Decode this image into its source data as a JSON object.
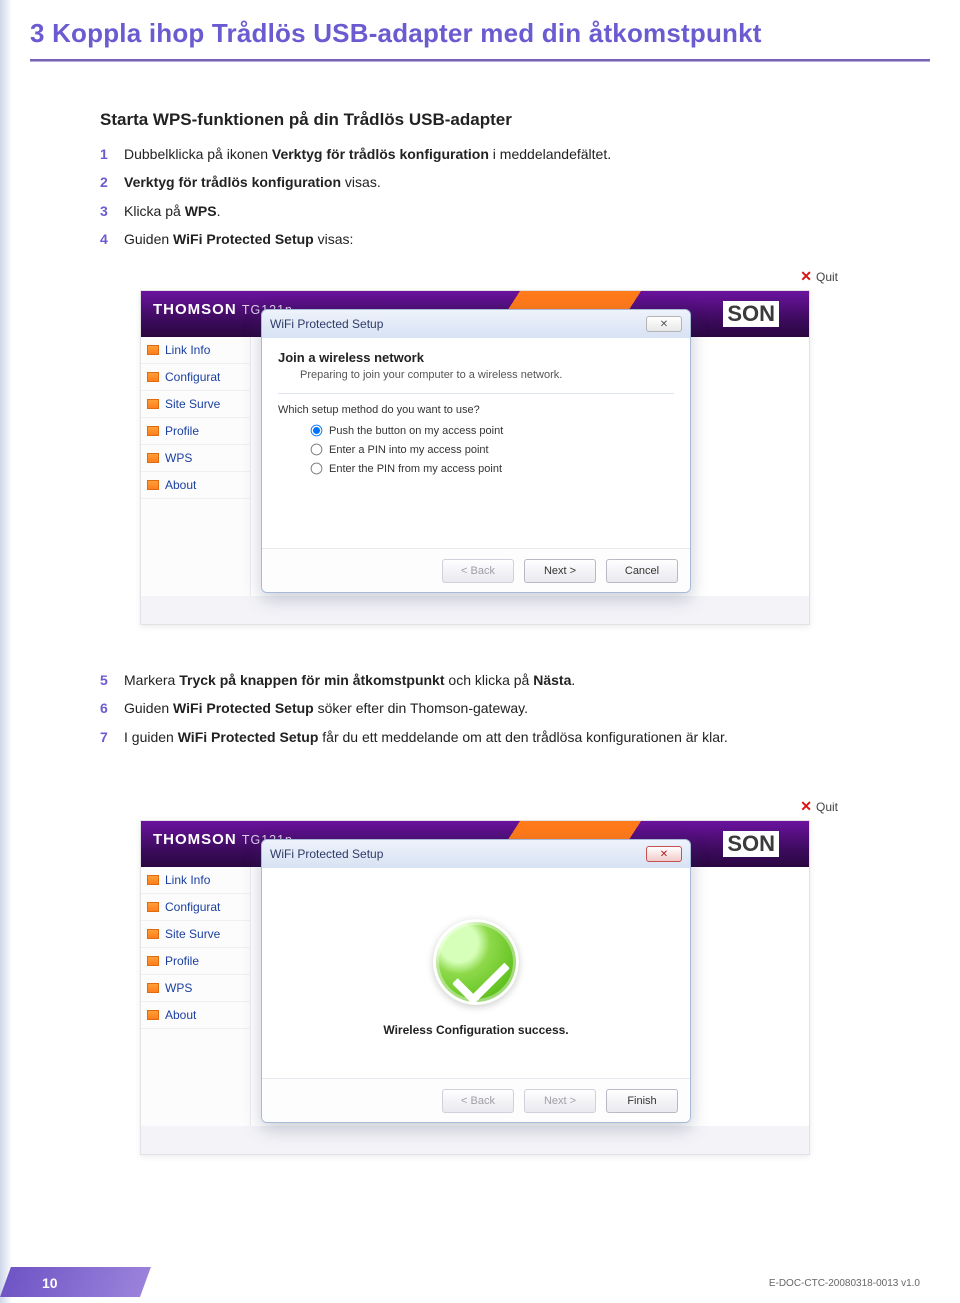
{
  "page": {
    "title": "3 Koppla ihop Trådlös USB-adapter med din åtkomstpunkt",
    "page_number": "10",
    "doc_id": "E-DOC-CTC-20080318-0013 v1.0"
  },
  "section": {
    "heading": "Starta WPS-funktionen på din Trådlös USB-adapter"
  },
  "steps_a": {
    "n1": "1",
    "t1a": "Dubbelklicka på ikonen ",
    "t1b": "Verktyg för trådlös konfiguration",
    "t1c": " i meddelandefältet.",
    "n2": "2",
    "t2a": "Verktyg för trådlös konfiguration",
    "t2b": " visas.",
    "n3": "3",
    "t3a": "Klicka på ",
    "t3b": "WPS",
    "t3c": ".",
    "n4": "4",
    "t4a": "Guiden ",
    "t4b": "WiFi Protected Setup",
    "t4c": " visas:"
  },
  "steps_b": {
    "n5": "5",
    "t5a": "Markera ",
    "t5b": "Tryck på knappen för min åtkomstpunkt",
    "t5c": " och klicka på ",
    "t5d": "Nästa",
    "t5e": ".",
    "n6": "6",
    "t6a": "Guiden ",
    "t6b": "WiFi Protected Setup",
    "t6c": " söker efter din Thomson-gateway.",
    "n7": "7",
    "t7a": "I guiden ",
    "t7b": "WiFi Protected Setup",
    "t7c": " får du ett meddelande om att den trådlösa konfigurationen är klar."
  },
  "app": {
    "brand": "THOMSON ",
    "brand_model": "TG121n",
    "son": "SON",
    "quit_label": "Quit",
    "sidebar": [
      {
        "label": "Link Info"
      },
      {
        "label": "Configurat"
      },
      {
        "label": "Site Surve"
      },
      {
        "label": "Profile"
      },
      {
        "label": "WPS"
      },
      {
        "label": "About"
      }
    ]
  },
  "dialog1": {
    "title": "WiFi Protected Setup",
    "heading": "Join a wireless network",
    "subheading": "Preparing to join your computer to a wireless network.",
    "question": "Which setup method do you want to use?",
    "opt1": "Push the button on my access point",
    "opt2": "Enter a PIN into my access point",
    "opt3": "Enter the PIN from my access point",
    "btn_back": "< Back",
    "btn_next": "Next >",
    "btn_cancel": "Cancel",
    "winclose": "✕"
  },
  "dialog2": {
    "title": "WiFi Protected Setup",
    "success": "Wireless Configuration success.",
    "btn_back": "< Back",
    "btn_next": "Next >",
    "btn_finish": "Finish",
    "winclose": "✕"
  }
}
